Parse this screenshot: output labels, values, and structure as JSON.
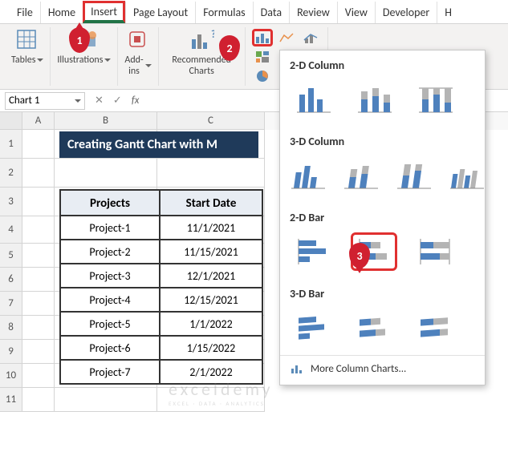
{
  "ribbon": {
    "tabs": [
      "File",
      "Home",
      "Insert",
      "Page Layout",
      "Formulas",
      "Data",
      "Review",
      "View",
      "Developer",
      "H"
    ],
    "active_tab": "Insert",
    "groups": {
      "tables": "Tables",
      "illustrations": "Illustrations",
      "addins": "Add-\nins",
      "recommended": "Recommended\nCharts"
    }
  },
  "badges": {
    "b1": "1",
    "b2": "2",
    "b3": "3"
  },
  "namebox": {
    "value": "Chart 1"
  },
  "fx": {
    "cancel": "✕",
    "confirm": "✓",
    "label": "fx"
  },
  "cols": [
    "A",
    "B",
    "C"
  ],
  "rows": [
    "1",
    "2",
    "3",
    "4",
    "5",
    "6",
    "7",
    "8",
    "9",
    "10",
    "11"
  ],
  "banner": {
    "title": "Creating Gantt Chart with M"
  },
  "table": {
    "headers": [
      "Projects",
      "Start Date"
    ],
    "data": [
      [
        "Project-1",
        "11/1/2021"
      ],
      [
        "Project-2",
        "11/15/2021"
      ],
      [
        "Project-3",
        "12/1/2021"
      ],
      [
        "Project-4",
        "12/15/2021"
      ],
      [
        "Project-5",
        "1/1/2022"
      ],
      [
        "Project-6",
        "1/15/2022"
      ],
      [
        "Project-7",
        "2/1/2022"
      ]
    ]
  },
  "dropdown": {
    "sec1": "2-D Column",
    "sec2": "3-D Column",
    "sec3": "2-D Bar",
    "sec4": "3-D Bar",
    "more": "More Column Charts..."
  },
  "watermark": {
    "big": "exceldemy",
    "small": "EXCEL · DATA · ANALYTICS"
  }
}
